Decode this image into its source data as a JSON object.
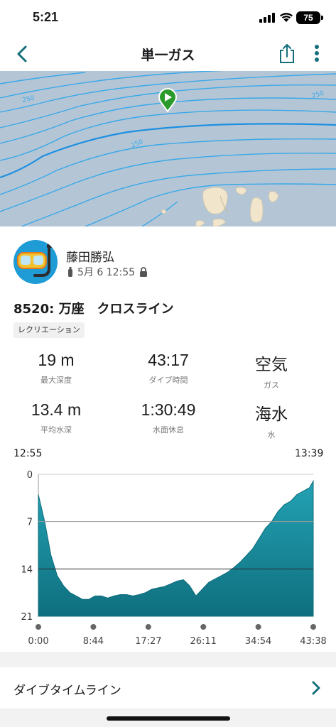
{
  "status_bar": {
    "time": "5:21",
    "battery": "75"
  },
  "nav": {
    "title": "単一ガス"
  },
  "map": {
    "contour_labels": [
      "250",
      "250",
      "250"
    ]
  },
  "profile": {
    "name": "藤田勝弘",
    "date": "5月 6 12:55"
  },
  "dive": {
    "title": "8520: 万座　クロスライン",
    "tag": "レクリエーション"
  },
  "stats": [
    {
      "value": "19 m",
      "label": "最大深度"
    },
    {
      "value": "43:17",
      "label": "ダイブ時間"
    },
    {
      "value": "空気",
      "label": "ガス"
    },
    {
      "value": "13.4 m",
      "label": "平均水深"
    },
    {
      "value": "1:30:49",
      "label": "水面休息"
    },
    {
      "value": "海水",
      "label": "水"
    }
  ],
  "chart_data": {
    "type": "area",
    "start_time": "12:55",
    "end_time": "13:39",
    "y_ticks": [
      "0",
      "7",
      "14",
      "21"
    ],
    "ylim": [
      0,
      21
    ],
    "x_ticks": [
      "0:00",
      "8:44",
      "17:27",
      "26:11",
      "34:54",
      "43:38"
    ],
    "reference_lines": [
      7,
      14
    ],
    "color": "#1a8fa0",
    "series": [
      {
        "x": [
          0,
          1,
          2,
          3,
          4,
          5,
          6,
          7,
          8,
          9,
          10,
          11,
          12,
          13,
          14,
          15,
          16,
          17,
          18,
          19,
          20,
          21,
          22,
          23,
          24,
          25,
          26,
          27,
          28,
          29,
          30,
          31,
          32,
          33,
          34,
          35,
          36,
          37,
          38,
          39,
          40,
          41,
          42,
          43,
          43.6
        ],
        "y": [
          3,
          7,
          12,
          15,
          16.5,
          17.5,
          18,
          18.5,
          18.5,
          18,
          18,
          18.3,
          18,
          17.8,
          17.8,
          18,
          17.8,
          17.5,
          17,
          16.8,
          16.6,
          16.2,
          15.8,
          15.6,
          16.5,
          18,
          17,
          16,
          15.5,
          15,
          14.5,
          13.8,
          13,
          12,
          11,
          9.5,
          8,
          7,
          5.5,
          4.5,
          4,
          3,
          2.5,
          2,
          1
        ]
      }
    ]
  },
  "timeline": {
    "label": "ダイブタイムライン"
  }
}
